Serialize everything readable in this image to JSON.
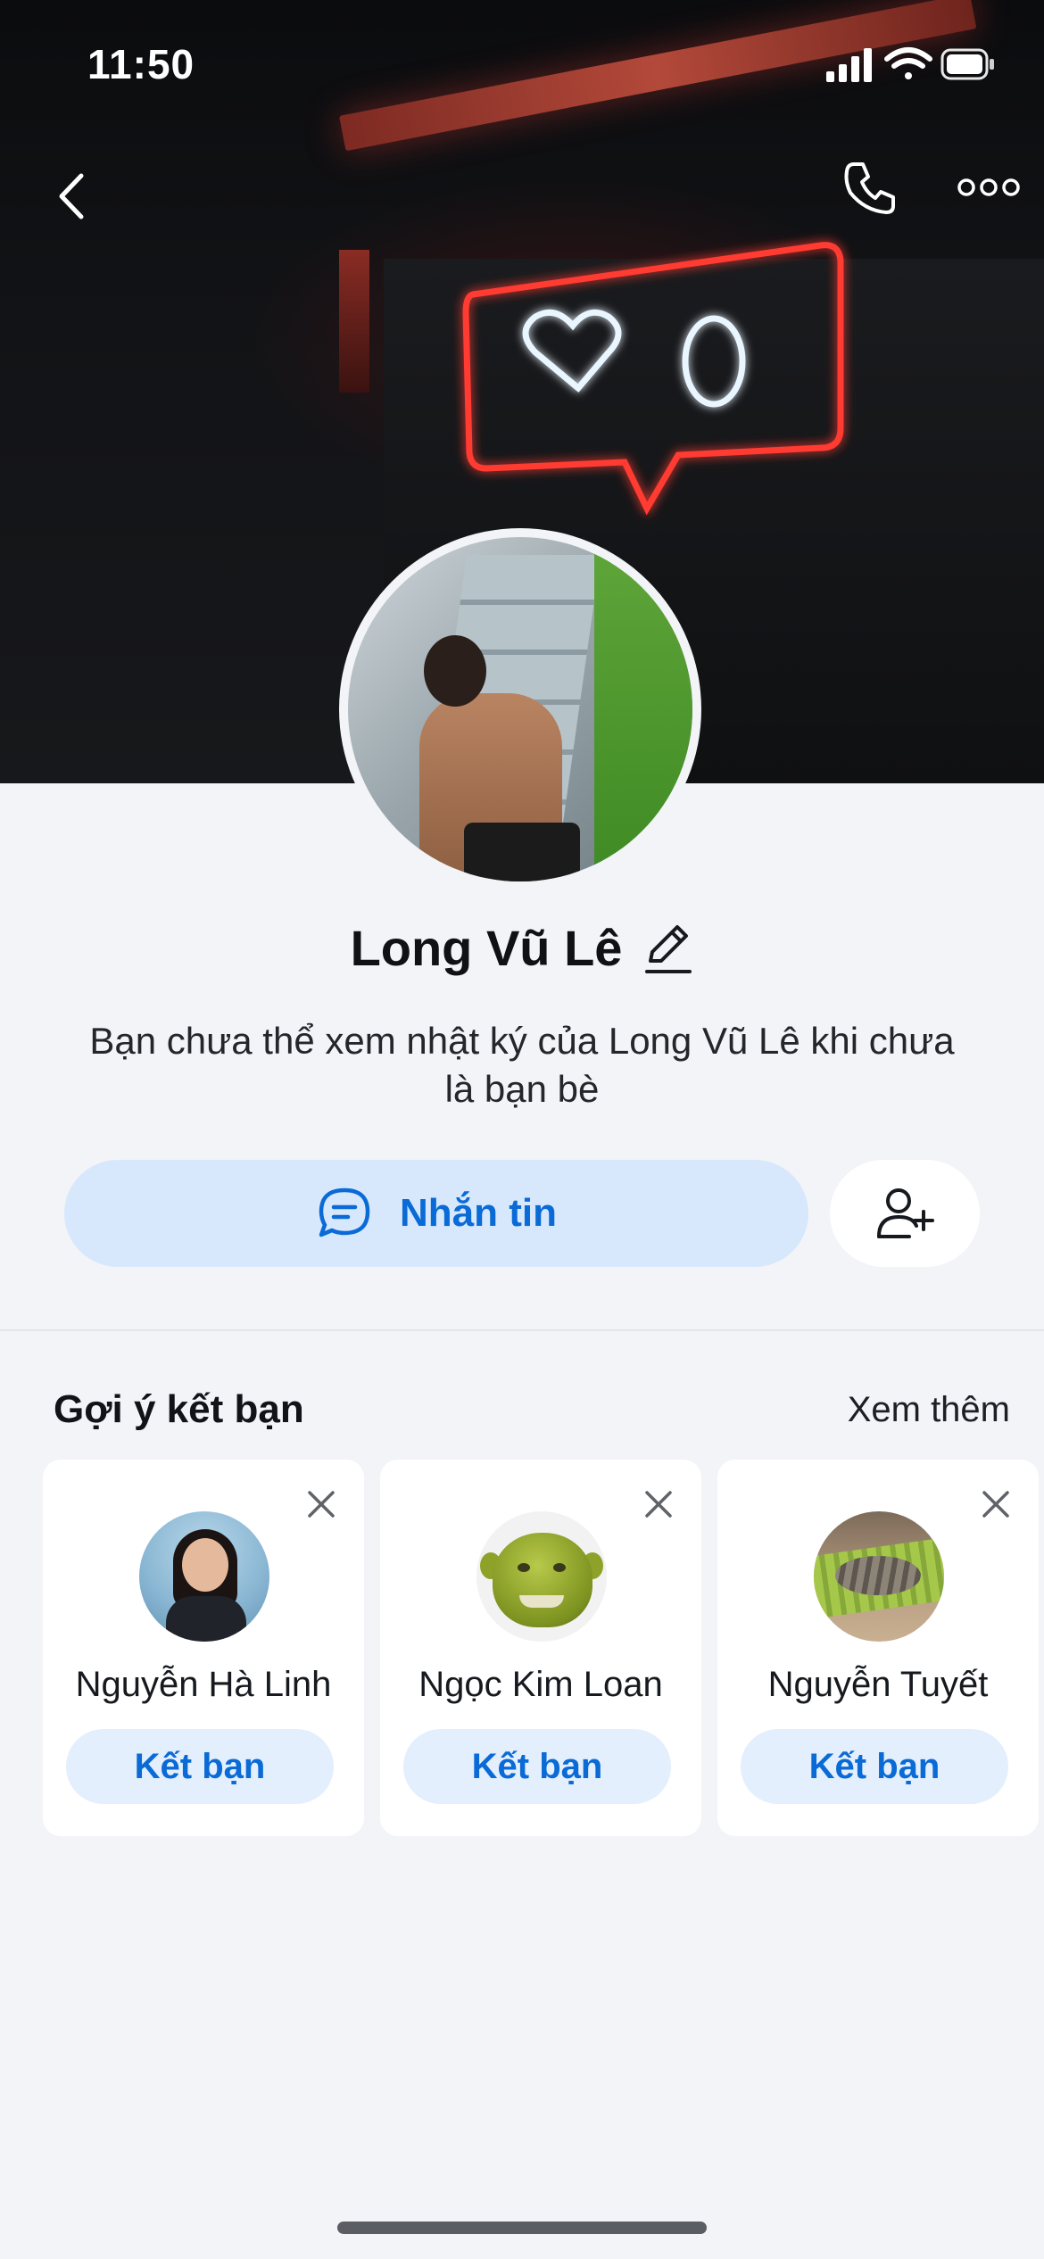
{
  "status_bar": {
    "time": "11:50",
    "icons": [
      "cellular-signal-icon",
      "wifi-icon",
      "battery-icon"
    ]
  },
  "nav_bar": {
    "back_icon": "chevron-left-icon",
    "call_icon": "phone-icon",
    "more_icon": "more-horizontal-icon"
  },
  "profile": {
    "name": "Long Vũ Lê",
    "edit_icon": "pencil-icon",
    "description": "Bạn chưa thể xem nhật ký của Long Vũ Lê khi chưa là bạn bè",
    "message_button_label": "Nhắn tin",
    "message_icon": "chat-bubble-icon",
    "add_friend_icon": "add-user-icon"
  },
  "suggestions": {
    "title": "Gợi ý kết bạn",
    "see_more": "Xem thêm",
    "cards": [
      {
        "name": "Nguyễn Hà Linh",
        "button_label": "Kết bạn"
      },
      {
        "name": "Ngọc Kim Loan",
        "button_label": "Kết bạn"
      },
      {
        "name": "Nguyễn Tuyết",
        "button_label": "Kết bạn"
      }
    ]
  },
  "colors": {
    "accent": "#0a6ad6",
    "button_bg": "#d7e8fd",
    "page_bg": "#f3f4f7",
    "neon_red": "#ff3b30",
    "neon_blue": "#bfe3ff"
  }
}
